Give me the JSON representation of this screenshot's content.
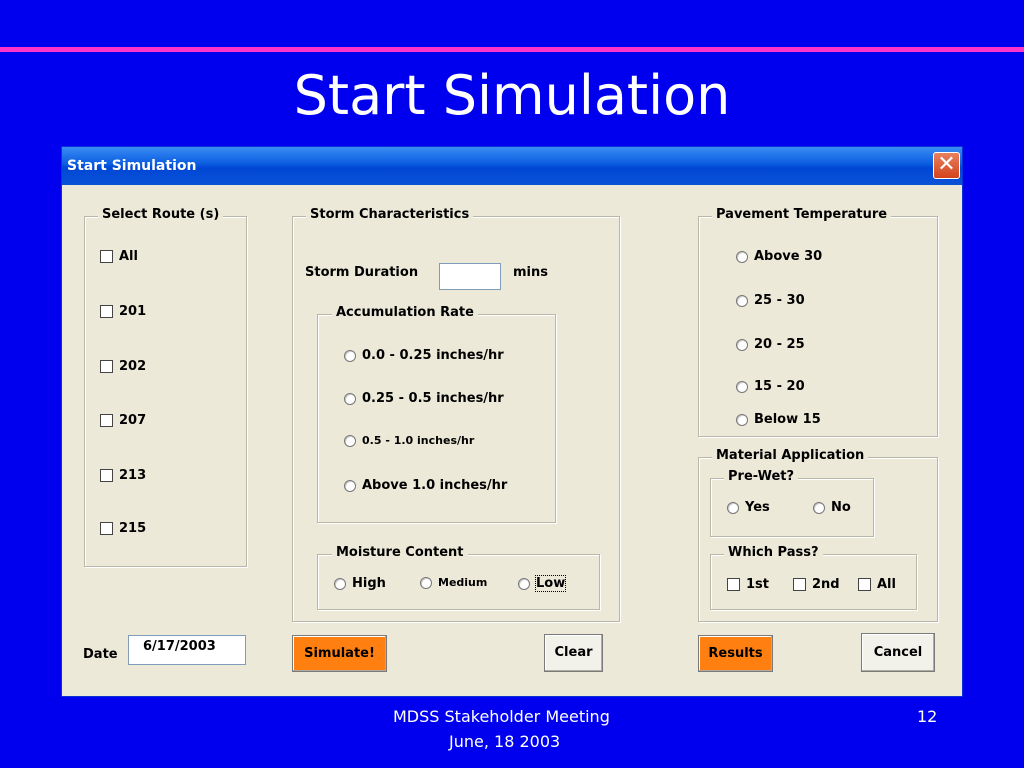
{
  "slide": {
    "title": "Start Simulation",
    "footer_line1": "MDSS Stakeholder Meeting",
    "footer_line2": "June, 18 2003",
    "page_number": "12",
    "colors": {
      "background": "#0000ee",
      "accent_line": "#ff33cc",
      "action_button": "#ff8010"
    }
  },
  "dialog": {
    "title": "Start Simulation",
    "close_icon": "close-icon",
    "routes": {
      "legend": "Select Route (s)",
      "items": [
        "All",
        "201",
        "202",
        "207",
        "213",
        "215"
      ]
    },
    "storm": {
      "legend": "Storm Characteristics",
      "duration_label": "Storm Duration",
      "duration_value": "",
      "duration_unit": "mins",
      "accumulation": {
        "legend": "Accumulation Rate",
        "options": [
          "0.0 - 0.25 inches/hr",
          "0.25 - 0.5 inches/hr",
          "0.5 - 1.0 inches/hr",
          "Above 1.0 inches/hr"
        ]
      },
      "moisture": {
        "legend": "Moisture Content",
        "options": [
          "High",
          "Medium",
          "Low"
        ],
        "focused": "Low"
      }
    },
    "pavement": {
      "legend": "Pavement Temperature",
      "options": [
        "Above 30",
        "25 - 30",
        "20 - 25",
        "15 - 20",
        "Below 15"
      ]
    },
    "material": {
      "legend": "Material Application",
      "prewet": {
        "legend": "Pre-Wet?",
        "options": [
          "Yes",
          "No"
        ]
      },
      "pass": {
        "legend": "Which Pass?",
        "options": [
          "1st",
          "2nd",
          "All"
        ]
      }
    },
    "date": {
      "label": "Date",
      "value": "6/17/2003"
    },
    "buttons": {
      "simulate": "Simulate!",
      "clear": "Clear",
      "results": "Results",
      "cancel": "Cancel"
    }
  }
}
